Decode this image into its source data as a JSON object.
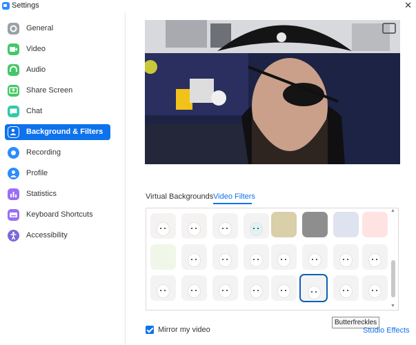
{
  "window": {
    "title": "Settings",
    "close_glyph": "✕"
  },
  "sidebar": {
    "items": [
      {
        "label": "General",
        "icon": "gear-icon",
        "color": "#9aa0a6",
        "active": false
      },
      {
        "label": "Video",
        "icon": "camera-icon",
        "color": "#44c767",
        "active": false
      },
      {
        "label": "Audio",
        "icon": "headphones-icon",
        "color": "#44c767",
        "active": false
      },
      {
        "label": "Share Screen",
        "icon": "share-screen-icon",
        "color": "#44c767",
        "active": false
      },
      {
        "label": "Chat",
        "icon": "chat-icon",
        "color": "#33c9a8",
        "active": false
      },
      {
        "label": "Background & Filters",
        "icon": "person-background-icon",
        "color": "#ffffff",
        "active": true
      },
      {
        "label": "Recording",
        "icon": "record-icon",
        "color": "#2d8cff",
        "active": false
      },
      {
        "label": "Profile",
        "icon": "profile-icon",
        "color": "#2d8cff",
        "active": false
      },
      {
        "label": "Statistics",
        "icon": "statistics-icon",
        "color": "#9b6ff5",
        "active": false
      },
      {
        "label": "Keyboard Shortcuts",
        "icon": "keyboard-icon",
        "color": "#9b6ff5",
        "active": false
      },
      {
        "label": "Accessibility",
        "icon": "accessibility-icon",
        "color": "#7b68d8",
        "active": false
      }
    ]
  },
  "tabs": {
    "virtual_backgrounds": "Virtual Backgrounds",
    "video_filters": "Video Filters",
    "active": "Video Filters"
  },
  "filters": {
    "rows": [
      [
        "bunny-ears",
        "mouse-ears",
        "unicorn-horn",
        "unicorn-mask",
        "frame-light",
        "frame-tv",
        "bird",
        "plant"
      ],
      [
        "rainbow",
        "sunglasses",
        "sleepy",
        "bandana",
        "antenna",
        "sparkle",
        "flower-crown",
        "flower"
      ],
      [
        "chef-hat",
        "graduation-cap",
        "beret",
        "mustache",
        "bandit-hat",
        "pirate-hat",
        "black-hat",
        "graduation-hat-dark"
      ]
    ],
    "selected": "pirate-hat",
    "tooltip": "Butterfreckles"
  },
  "footer": {
    "mirror_label": "Mirror my video",
    "mirror_checked": true,
    "studio_effects": "Studio Effects"
  },
  "colors": {
    "accent": "#0e72ed"
  }
}
